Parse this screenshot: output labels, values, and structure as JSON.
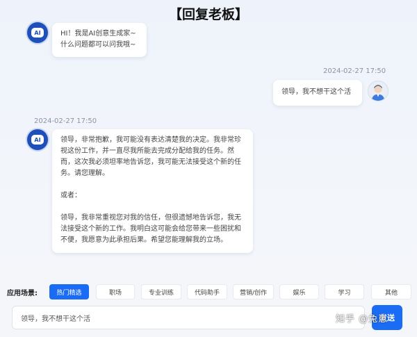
{
  "page": {
    "title": "【回复老板】"
  },
  "messages": {
    "bot_greeting": {
      "text": "HI！我是AI创意生成家~\n什么问题都可以问我哦~"
    },
    "user_msg": {
      "timestamp": "2024-02-27 17:50",
      "text": "领导，我不想干这个活"
    },
    "bot_reply": {
      "timestamp": "2024-02-27 17:50",
      "text": "领导，非常抱歉，我可能没有表达清楚我的决定。我非常珍视这份工作，并一直尽我所能去完成分配给我的任务。然而，这次我必须坦率地告诉您，我可能无法接受这个新的任务。请您理解。\n\n或者：\n\n领导，我非常重视您对我的信任，但很遗憾地告诉您，我无法接受这个新的工作。我明白这可能会给您带来一些困扰和不便，我愿意为此承担后果。希望您能理解我的立场。"
    }
  },
  "bot_avatar_label": "AI",
  "scenes": {
    "label": "应用场景:",
    "items": [
      "热门精选",
      "职场",
      "专业训练",
      "代码助手",
      "营销/创作",
      "娱乐",
      "学习",
      "其他"
    ]
  },
  "input": {
    "value": "领导，我不想干这个活"
  },
  "send_button": {
    "label": "发送"
  },
  "watermark": {
    "text": "知乎 @兔崽"
  },
  "colors": {
    "accent": "#1a6cf5",
    "bot_avatar": "#1f4fb8"
  }
}
